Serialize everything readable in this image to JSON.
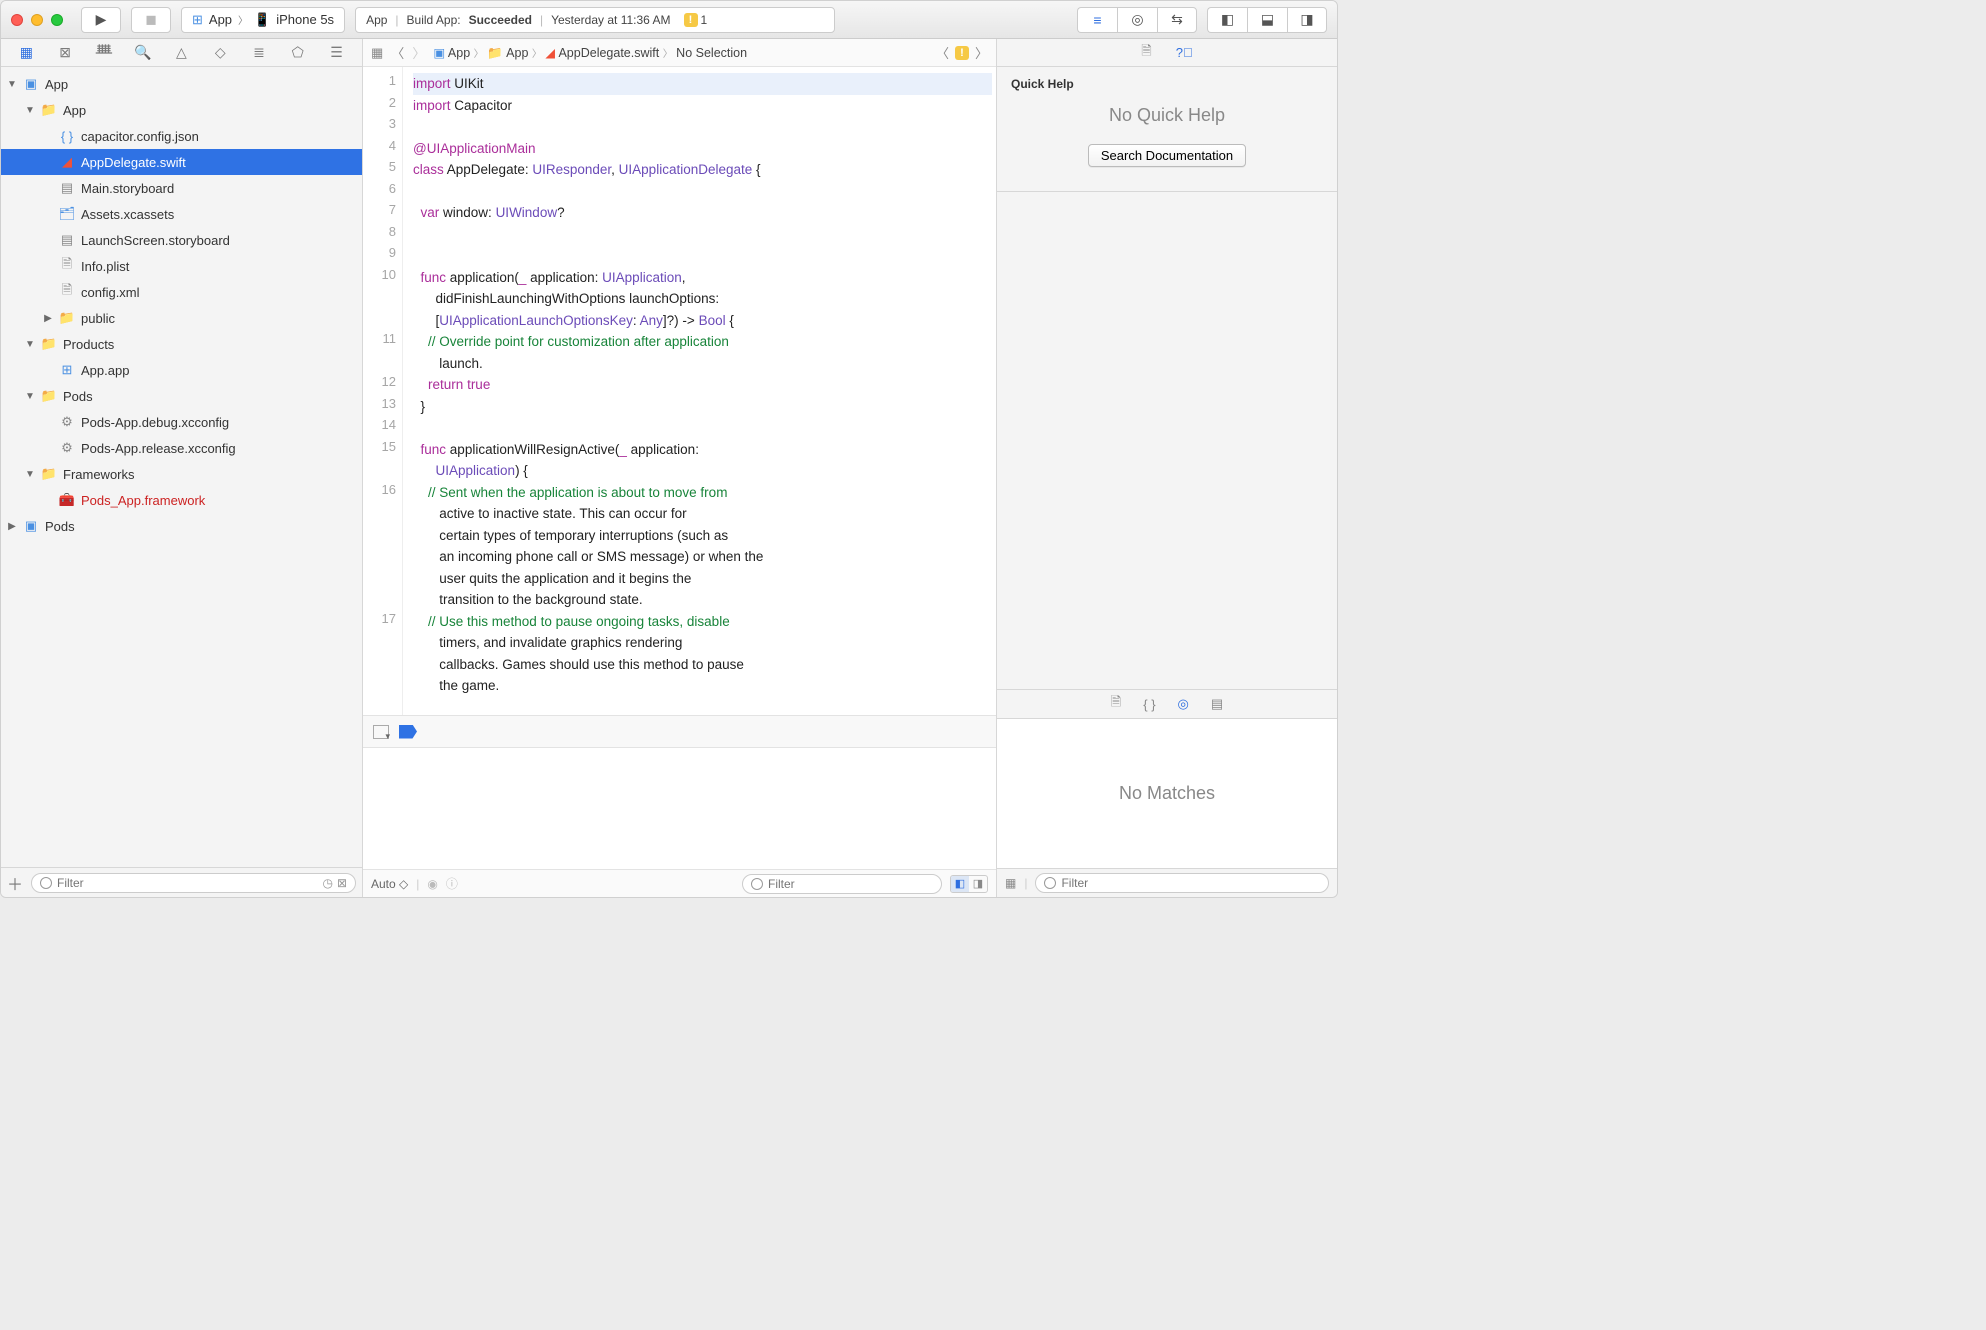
{
  "toolbar": {
    "scheme_app": "App",
    "scheme_device": "iPhone 5s"
  },
  "activity": {
    "product": "App",
    "build_prefix": "Build App:",
    "status": "Succeeded",
    "time": "Yesterday at 11:36 AM",
    "warning_count": "1"
  },
  "navigator": {
    "filter_placeholder": "Filter",
    "tree": [
      {
        "depth": 0,
        "arrow": "▼",
        "icon": "proj",
        "label": "App"
      },
      {
        "depth": 1,
        "arrow": "▼",
        "icon": "yfolder",
        "label": "App"
      },
      {
        "depth": 2,
        "arrow": "",
        "icon": "json",
        "label": "capacitor.config.json"
      },
      {
        "depth": 2,
        "arrow": "",
        "icon": "swift",
        "label": "AppDelegate.swift",
        "selected": true
      },
      {
        "depth": 2,
        "arrow": "",
        "icon": "story",
        "label": "Main.storyboard"
      },
      {
        "depth": 2,
        "arrow": "",
        "icon": "assets",
        "label": "Assets.xcassets"
      },
      {
        "depth": 2,
        "arrow": "",
        "icon": "story",
        "label": "LaunchScreen.storyboard"
      },
      {
        "depth": 2,
        "arrow": "",
        "icon": "plist",
        "label": "Info.plist"
      },
      {
        "depth": 2,
        "arrow": "",
        "icon": "file",
        "label": "config.xml"
      },
      {
        "depth": 2,
        "arrow": "▶",
        "icon": "folder",
        "label": "public"
      },
      {
        "depth": 1,
        "arrow": "▼",
        "icon": "yfolder",
        "label": "Products"
      },
      {
        "depth": 2,
        "arrow": "",
        "icon": "appprod",
        "label": "App.app"
      },
      {
        "depth": 1,
        "arrow": "▼",
        "icon": "yfolder",
        "label": "Pods"
      },
      {
        "depth": 2,
        "arrow": "",
        "icon": "config",
        "label": "Pods-App.debug.xcconfig"
      },
      {
        "depth": 2,
        "arrow": "",
        "icon": "config",
        "label": "Pods-App.release.xcconfig"
      },
      {
        "depth": 1,
        "arrow": "▼",
        "icon": "yfolder",
        "label": "Frameworks"
      },
      {
        "depth": 2,
        "arrow": "",
        "icon": "fw",
        "label": "Pods_App.framework",
        "red": true
      },
      {
        "depth": 0,
        "arrow": "▶",
        "icon": "proj",
        "label": "Pods"
      }
    ]
  },
  "jumpbar": {
    "items": [
      "App",
      "App",
      "AppDelegate.swift",
      "No Selection"
    ]
  },
  "code": {
    "lines": [
      {
        "n": "1",
        "html": "<span class='hl'><span class='kw'>import</span> UIKit</span>"
      },
      {
        "n": "2",
        "html": "<span class='kw'>import</span> Capacitor"
      },
      {
        "n": "3",
        "html": ""
      },
      {
        "n": "4",
        "html": "<span class='at'>@UIApplicationMain</span>"
      },
      {
        "n": "5",
        "html": "<span class='kw'>class</span> AppDelegate: <span class='ty'>UIResponder</span>, <span class='ty'>UIApplicationDelegate</span> {"
      },
      {
        "n": "6",
        "html": ""
      },
      {
        "n": "7",
        "html": "  <span class='kw'>var</span> window: <span class='ty'>UIWindow</span>?"
      },
      {
        "n": "8",
        "html": ""
      },
      {
        "n": "9",
        "html": ""
      },
      {
        "n": "10",
        "html": "  <span class='kw'>func</span> application(<span class='kw'>_</span> application: <span class='ty'>UIApplication</span>,\n      didFinishLaunchingWithOptions launchOptions:\n      [<span class='ty'>UIApplicationLaunchOptionsKey</span>: <span class='ty'>Any</span>]?) -> <span class='ty'>Bool</span> {"
      },
      {
        "n": "11",
        "html": "    <span class='cm'>// Override point for customization after application\n       launch.</span>"
      },
      {
        "n": "12",
        "html": "    <span class='kw'>return</span> <span class='kw'>true</span>"
      },
      {
        "n": "13",
        "html": "  }"
      },
      {
        "n": "14",
        "html": ""
      },
      {
        "n": "15",
        "html": "  <span class='kw'>func</span> applicationWillResignActive(<span class='kw'>_</span> application:\n      <span class='ty'>UIApplication</span>) {"
      },
      {
        "n": "16",
        "html": "    <span class='cm'>// Sent when the application is about to move from\n       active to inactive state. This can occur for\n       certain types of temporary interruptions (such as\n       an incoming phone call or SMS message) or when the\n       user quits the application and it begins the\n       transition to the background state.</span>"
      },
      {
        "n": "17",
        "html": "    <span class='cm'>// Use this method to pause ongoing tasks, disable\n       timers, and invalidate graphics rendering\n       callbacks. Games should use this method to pause\n       the game.</span>"
      }
    ]
  },
  "console": {
    "auto": "Auto",
    "filter": "Filter"
  },
  "inspector": {
    "title": "Quick Help",
    "no_help": "No Quick Help",
    "search_btn": "Search Documentation",
    "no_matches": "No Matches",
    "filter": "Filter"
  }
}
